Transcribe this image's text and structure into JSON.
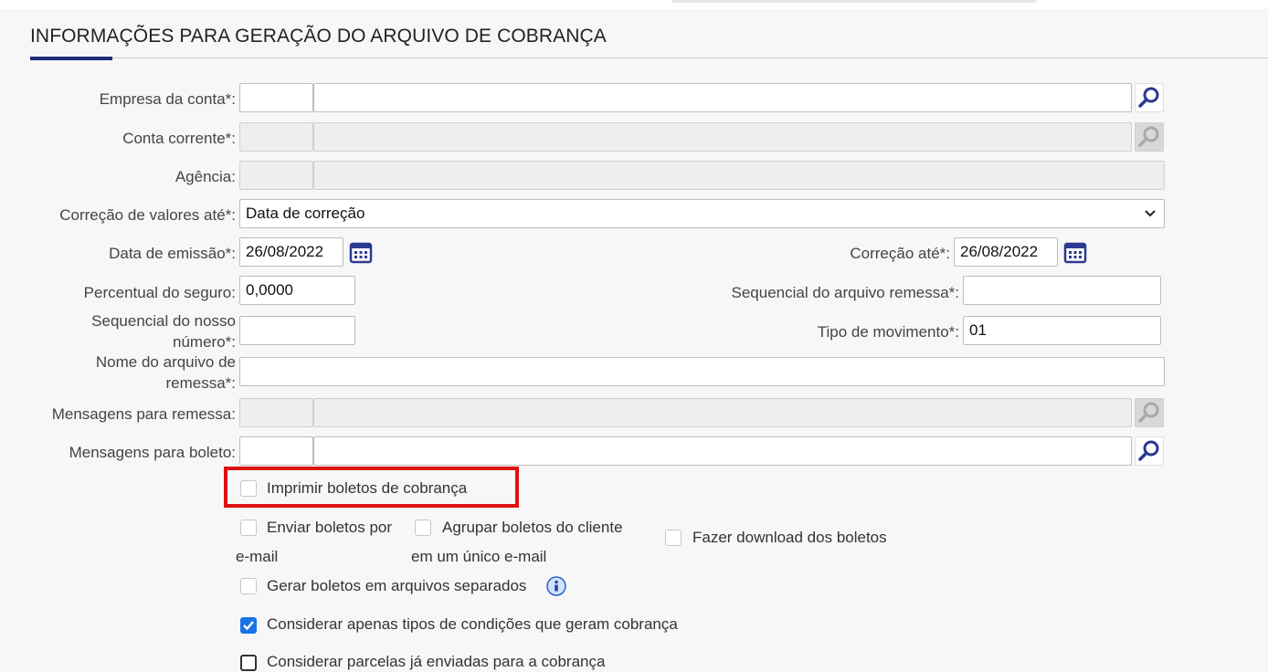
{
  "section": {
    "title": "INFORMAÇÕES PARA GERAÇÃO DO ARQUIVO DE COBRANÇA"
  },
  "fields": {
    "empresa": {
      "label": "Empresa da conta*:",
      "code": "",
      "name": ""
    },
    "conta": {
      "label": "Conta corrente*:",
      "code": "",
      "name": ""
    },
    "agencia": {
      "label": "Agência:",
      "code": "",
      "name": ""
    },
    "correcao_valores": {
      "label": "Correção de valores até*:",
      "value": "Data de correção"
    },
    "data_emissao": {
      "label": "Data de emissão*:",
      "value": "26/08/2022"
    },
    "correcao_ate": {
      "label": "Correção até*:",
      "value": "26/08/2022"
    },
    "percentual_seguro": {
      "label": "Percentual do seguro:",
      "value": "0,0000"
    },
    "sequencial_remessa": {
      "label": "Sequencial do arquivo remessa*:",
      "value": ""
    },
    "sequencial_nosso": {
      "label_line1": "Sequencial do nosso",
      "label_line2": "número*:",
      "value": ""
    },
    "tipo_movimento": {
      "label": "Tipo de movimento*:",
      "value": "01"
    },
    "nome_arquivo": {
      "label_line1": "Nome do arquivo de",
      "label_line2": "remessa*:",
      "value": ""
    },
    "mensagens_remessa": {
      "label": "Mensagens para remessa:",
      "code": "",
      "name": ""
    },
    "mensagens_boleto": {
      "label": "Mensagens para boleto:",
      "code": "",
      "name": ""
    }
  },
  "options": {
    "imprimir": {
      "label": "Imprimir boletos de cobrança",
      "checked": false
    },
    "enviar_email": {
      "label_line1": "Enviar boletos por",
      "label_line2": "e-mail",
      "checked": false
    },
    "agrupar": {
      "label_line1": "Agrupar boletos do cliente",
      "label_line2": "em um único e-mail",
      "checked": false
    },
    "download": {
      "label": "Fazer download dos boletos",
      "checked": false
    },
    "separados": {
      "label": "Gerar boletos em arquivos separados",
      "checked": false
    },
    "considerar_tipos": {
      "label": "Considerar apenas tipos de condições que geram cobrança",
      "checked": true
    },
    "considerar_parcelas": {
      "label": "Considerar parcelas já enviadas para a cobrança",
      "checked": false
    }
  },
  "icons": {
    "search": "search-icon",
    "calendar": "calendar-icon",
    "info": "info-icon",
    "chevron": "chevron-down-icon"
  },
  "colors": {
    "accent": "#1f2c7c",
    "icon": "#2b3990",
    "checkbox_checked": "#1a73e8",
    "highlight": "#e01010"
  }
}
